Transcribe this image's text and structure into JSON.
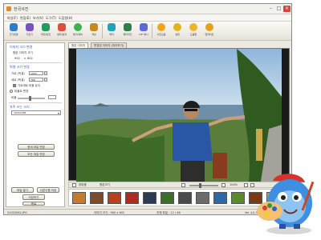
{
  "window": {
    "title": "한국사진"
  },
  "menu": [
    "파일(F)",
    "편집(E)",
    "보기(V)",
    "도구(T)",
    "도움말(H)"
  ],
  "toolbar": {
    "buttons": [
      {
        "label": "크기변경",
        "color": "#2f7bd1"
      },
      {
        "label": "자르기",
        "color": "#7a52c4"
      },
      {
        "label": "회전/반전",
        "color": "#1f9d5b"
      },
      {
        "label": "필터/효과",
        "color": "#e04d3a"
      },
      {
        "label": "밝기/대비",
        "color": "#3bb24c"
      },
      {
        "label": "색상",
        "color": "#c88a1a"
      },
      {
        "label": "액자",
        "color": "#1ea4b8"
      },
      {
        "label": "워터마크",
        "color": "#2d7f4a"
      },
      {
        "label": "GIF 애니",
        "color": "#5a6bd6"
      },
      {
        "label": "사진모음",
        "color": "#f2a31a"
      },
      {
        "label": "설정",
        "color": "#e3b21c"
      },
      {
        "label": "도움말",
        "color": "#f0b428"
      },
      {
        "label": "업데이트",
        "color": "#e2a21a"
      }
    ]
  },
  "left_panel": {
    "size_section": "이미지 크기 변경",
    "original_size_label": "원본 이미지 크기",
    "original_width": "900",
    "original_height": "602",
    "resize_section": "픽셀 크기 변경",
    "width_label": "가로 (픽셀)",
    "width_value": "1024",
    "height_label": "세로 (픽셀)",
    "height_value": "768",
    "keep_ratio_label": "가로세로 비율 유지",
    "percent_label": "비율로 변경",
    "percent_prefix": "비율",
    "preset_section": "자주 쓰는 크기",
    "preset_value": "1024x768",
    "apply_current_button": "현재 파일 변경",
    "apply_all_button": "모든 파일 변경",
    "open_button": "파일 열기",
    "save_button": "저장하기",
    "save_as_button": "다른이름 저장",
    "exit_button": "종료"
  },
  "tabs": [
    "원본 이미지",
    "변경된 이미지 (미리보기)"
  ],
  "zoom": {
    "value": "100%",
    "fit_label": "창맞춤",
    "actual_label": "원본크기"
  },
  "status": {
    "filename": "S1025062.JPG",
    "image_size": "이미지 크기 : 900 x 602",
    "file_count": "전체 파일 : 12 / 48",
    "version": "Ver 4.0.3 (1.0.14)"
  },
  "thumbnails": [
    {
      "color": "#c57b2e"
    },
    {
      "color": "#7c4a2f"
    },
    {
      "color": "#b9401f"
    },
    {
      "color": "#b02a22"
    },
    {
      "color": "#2b3a55"
    },
    {
      "color": "#3d6e2e"
    },
    {
      "color": "#4a4a4a"
    },
    {
      "color": "#6b6b6b"
    },
    {
      "color": "#2b6aa6"
    },
    {
      "color": "#5b8a2c"
    },
    {
      "color": "#7a3a14"
    },
    {
      "color": "#c9a030"
    }
  ]
}
